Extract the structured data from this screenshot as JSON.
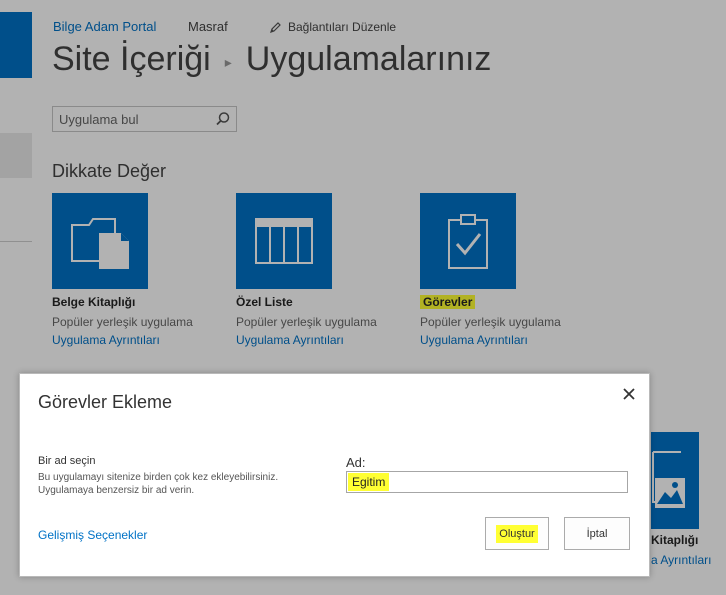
{
  "nav": {
    "home": "Bilge Adam Portal",
    "masraf": "Masraf",
    "edit_links": "Bağlantıları Düzenle"
  },
  "title": {
    "part1": "Site İçeriği",
    "separator": "▸",
    "part2": "Uygulamalarınız"
  },
  "search": {
    "placeholder": "Uygulama bul"
  },
  "section": {
    "title": "Dikkate Değer"
  },
  "apps": [
    {
      "name": "Belge Kitaplığı",
      "desc": "Popüler yerleşik uygulama",
      "link": "Uygulama Ayrıntıları",
      "icon": "folder-document-icon"
    },
    {
      "name": "Özel Liste",
      "desc": "Popüler yerleşik uygulama",
      "link": "Uygulama Ayrıntıları",
      "icon": "table-grid-icon"
    },
    {
      "name": "Görevler",
      "desc": "Popüler yerleşik uygulama",
      "link": "Uygulama Ayrıntıları",
      "icon": "clipboard-check-icon"
    }
  ],
  "bg_right": {
    "name": "Kitaplığı",
    "link": "a Ayrıntıları"
  },
  "dialog": {
    "title": "Görevler Ekleme",
    "label": "Bir ad seçin",
    "help": "Bu uygulamayı sitenize birden çok kez ekleyebilirsiniz. Uygulamaya benzersiz bir ad verin.",
    "name_label": "Ad:",
    "name_value": "Egitim",
    "advanced": "Gelişmiş Seçenekler",
    "ok": "Oluştur",
    "cancel": "İptal"
  },
  "colors": {
    "accent": "#0072c6",
    "highlight": "#ffff33"
  }
}
